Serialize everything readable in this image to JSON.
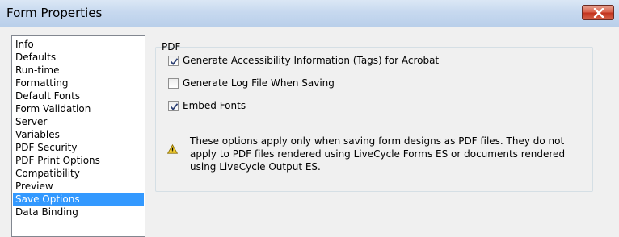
{
  "window": {
    "title": "Form Properties"
  },
  "nav": {
    "items": [
      {
        "label": "Info",
        "selected": false
      },
      {
        "label": "Defaults",
        "selected": false
      },
      {
        "label": "Run-time",
        "selected": false
      },
      {
        "label": "Formatting",
        "selected": false
      },
      {
        "label": "Default Fonts",
        "selected": false
      },
      {
        "label": "Form Validation",
        "selected": false
      },
      {
        "label": "Server",
        "selected": false
      },
      {
        "label": "Variables",
        "selected": false
      },
      {
        "label": "PDF Security",
        "selected": false
      },
      {
        "label": "PDF Print Options",
        "selected": false
      },
      {
        "label": "Compatibility",
        "selected": false
      },
      {
        "label": "Preview",
        "selected": false
      },
      {
        "label": "Save Options",
        "selected": true
      },
      {
        "label": "Data Binding",
        "selected": false
      }
    ]
  },
  "pdf_group": {
    "label": "PDF",
    "options": [
      {
        "label": "Generate Accessibility Information (Tags) for Acrobat",
        "checked": true
      },
      {
        "label": "Generate Log File When Saving",
        "checked": false
      },
      {
        "label": "Embed Fonts",
        "checked": true
      }
    ],
    "note": "These options apply only when saving form designs as PDF files. They do not apply to PDF files rendered using LiveCycle Forms ES or documents rendered using LiveCycle Output ES."
  },
  "colors": {
    "selection": "#3399ff",
    "close_button": "#c7432f"
  }
}
